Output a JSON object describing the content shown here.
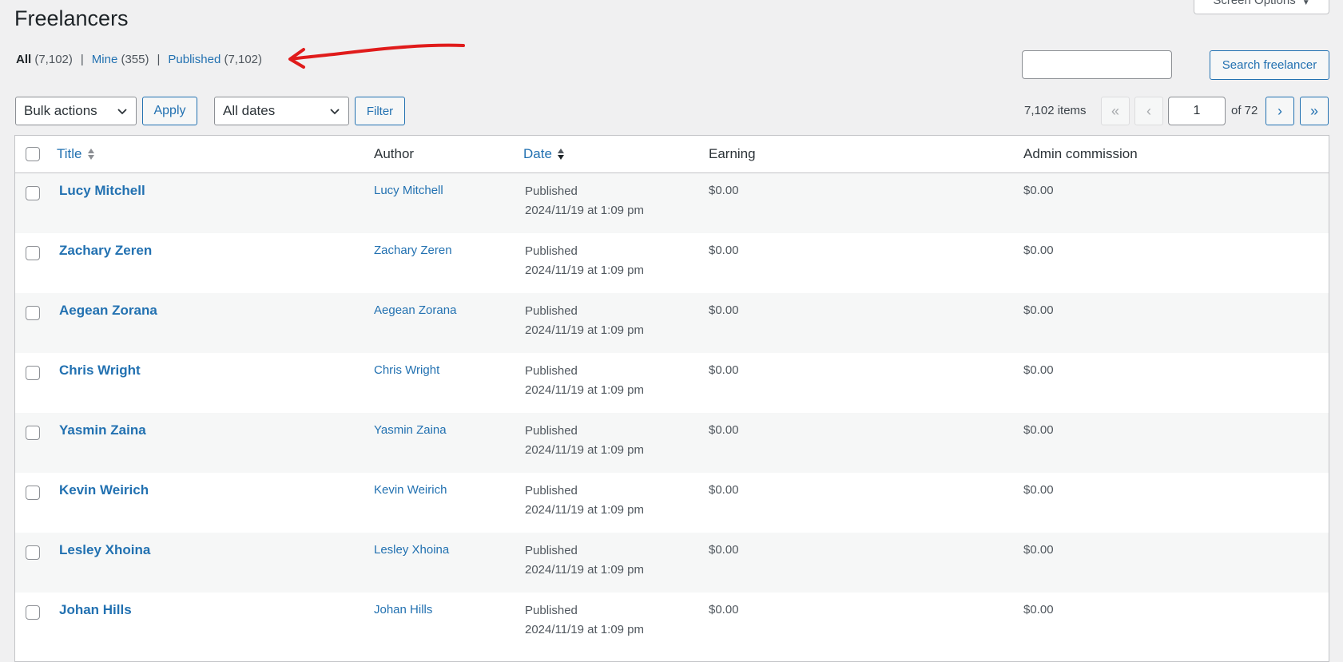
{
  "page": {
    "title": "Freelancers"
  },
  "screen_options": {
    "label": "Screen Options",
    "caret": "▼"
  },
  "views": [
    {
      "label": "All",
      "count": "(7,102)",
      "current": true
    },
    {
      "label": "Mine",
      "count": "(355)",
      "current": false
    },
    {
      "label": "Published",
      "count": "(7,102)",
      "current": false
    }
  ],
  "search": {
    "value": "",
    "button": "Search freelancer"
  },
  "bulk": {
    "selected": "Bulk actions",
    "apply": "Apply"
  },
  "dates": {
    "selected": "All dates",
    "filter": "Filter"
  },
  "pagination": {
    "items": "7,102 items",
    "first": "«",
    "prev": "‹",
    "current_page": "1",
    "of": "of 72",
    "next": "›",
    "last": "»"
  },
  "table": {
    "columns": {
      "title": "Title",
      "author": "Author",
      "date": "Date",
      "earning": "Earning",
      "commission": "Admin commission"
    },
    "rows": [
      {
        "title": "Lucy Mitchell",
        "author": "Lucy Mitchell",
        "status": "Published",
        "date": "2024/11/19 at 1:09 pm",
        "earning": "$0.00",
        "commission": "$0.00"
      },
      {
        "title": "Zachary Zeren",
        "author": "Zachary Zeren",
        "status": "Published",
        "date": "2024/11/19 at 1:09 pm",
        "earning": "$0.00",
        "commission": "$0.00"
      },
      {
        "title": "Aegean Zorana",
        "author": "Aegean Zorana",
        "status": "Published",
        "date": "2024/11/19 at 1:09 pm",
        "earning": "$0.00",
        "commission": "$0.00"
      },
      {
        "title": "Chris Wright",
        "author": "Chris Wright",
        "status": "Published",
        "date": "2024/11/19 at 1:09 pm",
        "earning": "$0.00",
        "commission": "$0.00"
      },
      {
        "title": "Yasmin Zaina",
        "author": "Yasmin Zaina",
        "status": "Published",
        "date": "2024/11/19 at 1:09 pm",
        "earning": "$0.00",
        "commission": "$0.00"
      },
      {
        "title": "Kevin Weirich",
        "author": "Kevin Weirich",
        "status": "Published",
        "date": "2024/11/19 at 1:09 pm",
        "earning": "$0.00",
        "commission": "$0.00"
      },
      {
        "title": "Lesley Xhoina",
        "author": "Lesley Xhoina",
        "status": "Published",
        "date": "2024/11/19 at 1:09 pm",
        "earning": "$0.00",
        "commission": "$0.00"
      },
      {
        "title": "Johan Hills",
        "author": "Johan Hills",
        "status": "Published",
        "date": "2024/11/19 at 1:09 pm",
        "earning": "$0.00",
        "commission": "$0.00"
      }
    ]
  },
  "colors": {
    "link": "#2271b1",
    "annotation_arrow": "#e01b1b"
  }
}
